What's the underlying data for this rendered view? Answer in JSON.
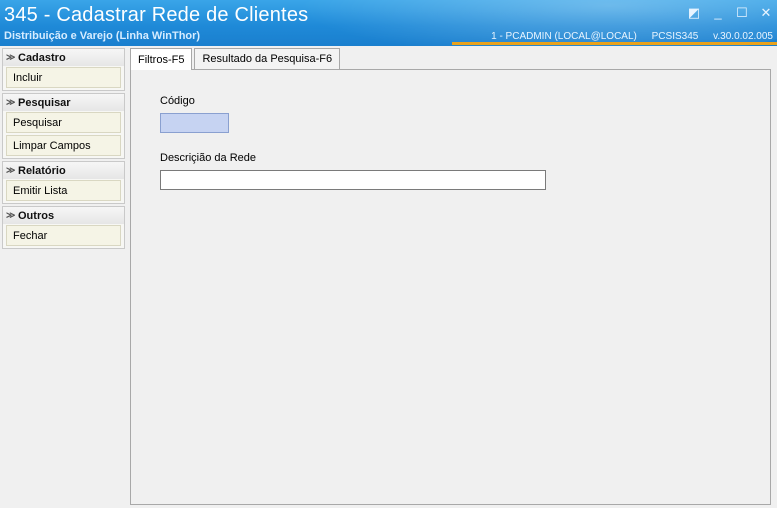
{
  "window": {
    "title": "345 - Cadastrar Rede de Clientes",
    "subtitle": "Distribuição e Varejo (Linha WinThor)",
    "session_user": "1 - PCADMIN (LOCAL@LOCAL)",
    "module": "PCSIS345",
    "version": "v.30.0.02.005",
    "accent_color": "#e9a21d",
    "buttons": {
      "restore_icon": "◩",
      "minimize_icon": "_",
      "maximize_icon": "☐",
      "close_icon": "✕"
    }
  },
  "sidebar": {
    "groups": [
      {
        "header": "Cadastro",
        "items": [
          "Incluir"
        ]
      },
      {
        "header": "Pesquisar",
        "items": [
          "Pesquisar",
          "Limpar Campos"
        ]
      },
      {
        "header": "Relatório",
        "items": [
          "Emitir Lista"
        ]
      },
      {
        "header": "Outros",
        "items": [
          "Fechar"
        ]
      }
    ],
    "chevron": "≫"
  },
  "tabs": [
    {
      "label": "Filtros-F5",
      "active": true
    },
    {
      "label": "Resultado da Pesquisa-F6",
      "active": false
    }
  ],
  "form": {
    "codigo_label": "Código",
    "codigo_value": "",
    "descricao_label": "Descriçião da  Rede",
    "descricao_value": ""
  }
}
